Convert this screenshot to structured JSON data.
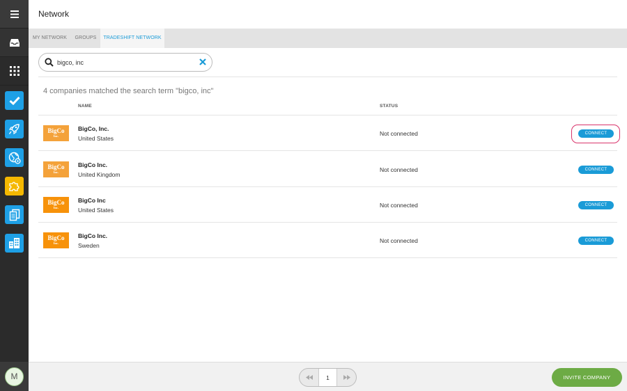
{
  "app": {
    "title": "Network",
    "colors": {
      "accent": "#1a9bd7",
      "success": "#6dab45",
      "highlight": "#d9336b"
    }
  },
  "rail": {
    "menu_icon": "hamburger-icon",
    "inbox_icon": "inbox-icon",
    "apps_icon": "app-grid-icon",
    "apps": [
      {
        "name": "tasks",
        "icon": "checkmark-icon",
        "color": "#1ea0e6"
      },
      {
        "name": "launch",
        "icon": "rocket-icon",
        "color": "#1ea0e6"
      },
      {
        "name": "network",
        "icon": "globe-gear-icon",
        "color": "#1ea0e6"
      },
      {
        "name": "integrations",
        "icon": "puzzle-icon",
        "color": "#f5b800"
      },
      {
        "name": "documents",
        "icon": "documents-icon",
        "color": "#1ea0e6"
      },
      {
        "name": "company",
        "icon": "building-icon",
        "color": "#1ea0e6"
      }
    ],
    "avatar_initial": "M"
  },
  "tabs": [
    {
      "label": "MY NETWORK",
      "active": false
    },
    {
      "label": "GROUPS",
      "active": false
    },
    {
      "label": "TRADESHIFT NETWORK",
      "active": true
    }
  ],
  "search": {
    "value": "bigco, inc"
  },
  "results": {
    "message": "4 companies matched the search term \"bigco, inc\"",
    "columns": {
      "name": "NAME",
      "status": "STATUS"
    },
    "rows": [
      {
        "logo_text": "BigCo",
        "logo_sub": "Inc.",
        "logo_color": "#f4a23a",
        "name": "BigCo, Inc.",
        "country": "United States",
        "status": "Not connected",
        "action": "CONNECT",
        "highlighted": true
      },
      {
        "logo_text": "BigCo",
        "logo_sub": "Inc.",
        "logo_color": "#f4a23a",
        "name": "BigCo Inc.",
        "country": "United Kingdom",
        "status": "Not connected",
        "action": "CONNECT",
        "highlighted": false
      },
      {
        "logo_text": "BigCo",
        "logo_sub": "Inc.",
        "logo_color": "#f7920a",
        "name": "BigCo Inc",
        "country": "United States",
        "status": "Not connected",
        "action": "CONNECT",
        "highlighted": false
      },
      {
        "logo_text": "BigCo",
        "logo_sub": "Inc.",
        "logo_color": "#f7920a",
        "name": "BigCo Inc.",
        "country": "Sweden",
        "status": "Not connected",
        "action": "CONNECT",
        "highlighted": false
      }
    ]
  },
  "footer": {
    "pager": {
      "prev_icon": "double-chevron-left-icon",
      "page": "1",
      "next_icon": "double-chevron-right-icon"
    },
    "invite_label": "INVITE COMPANY"
  }
}
